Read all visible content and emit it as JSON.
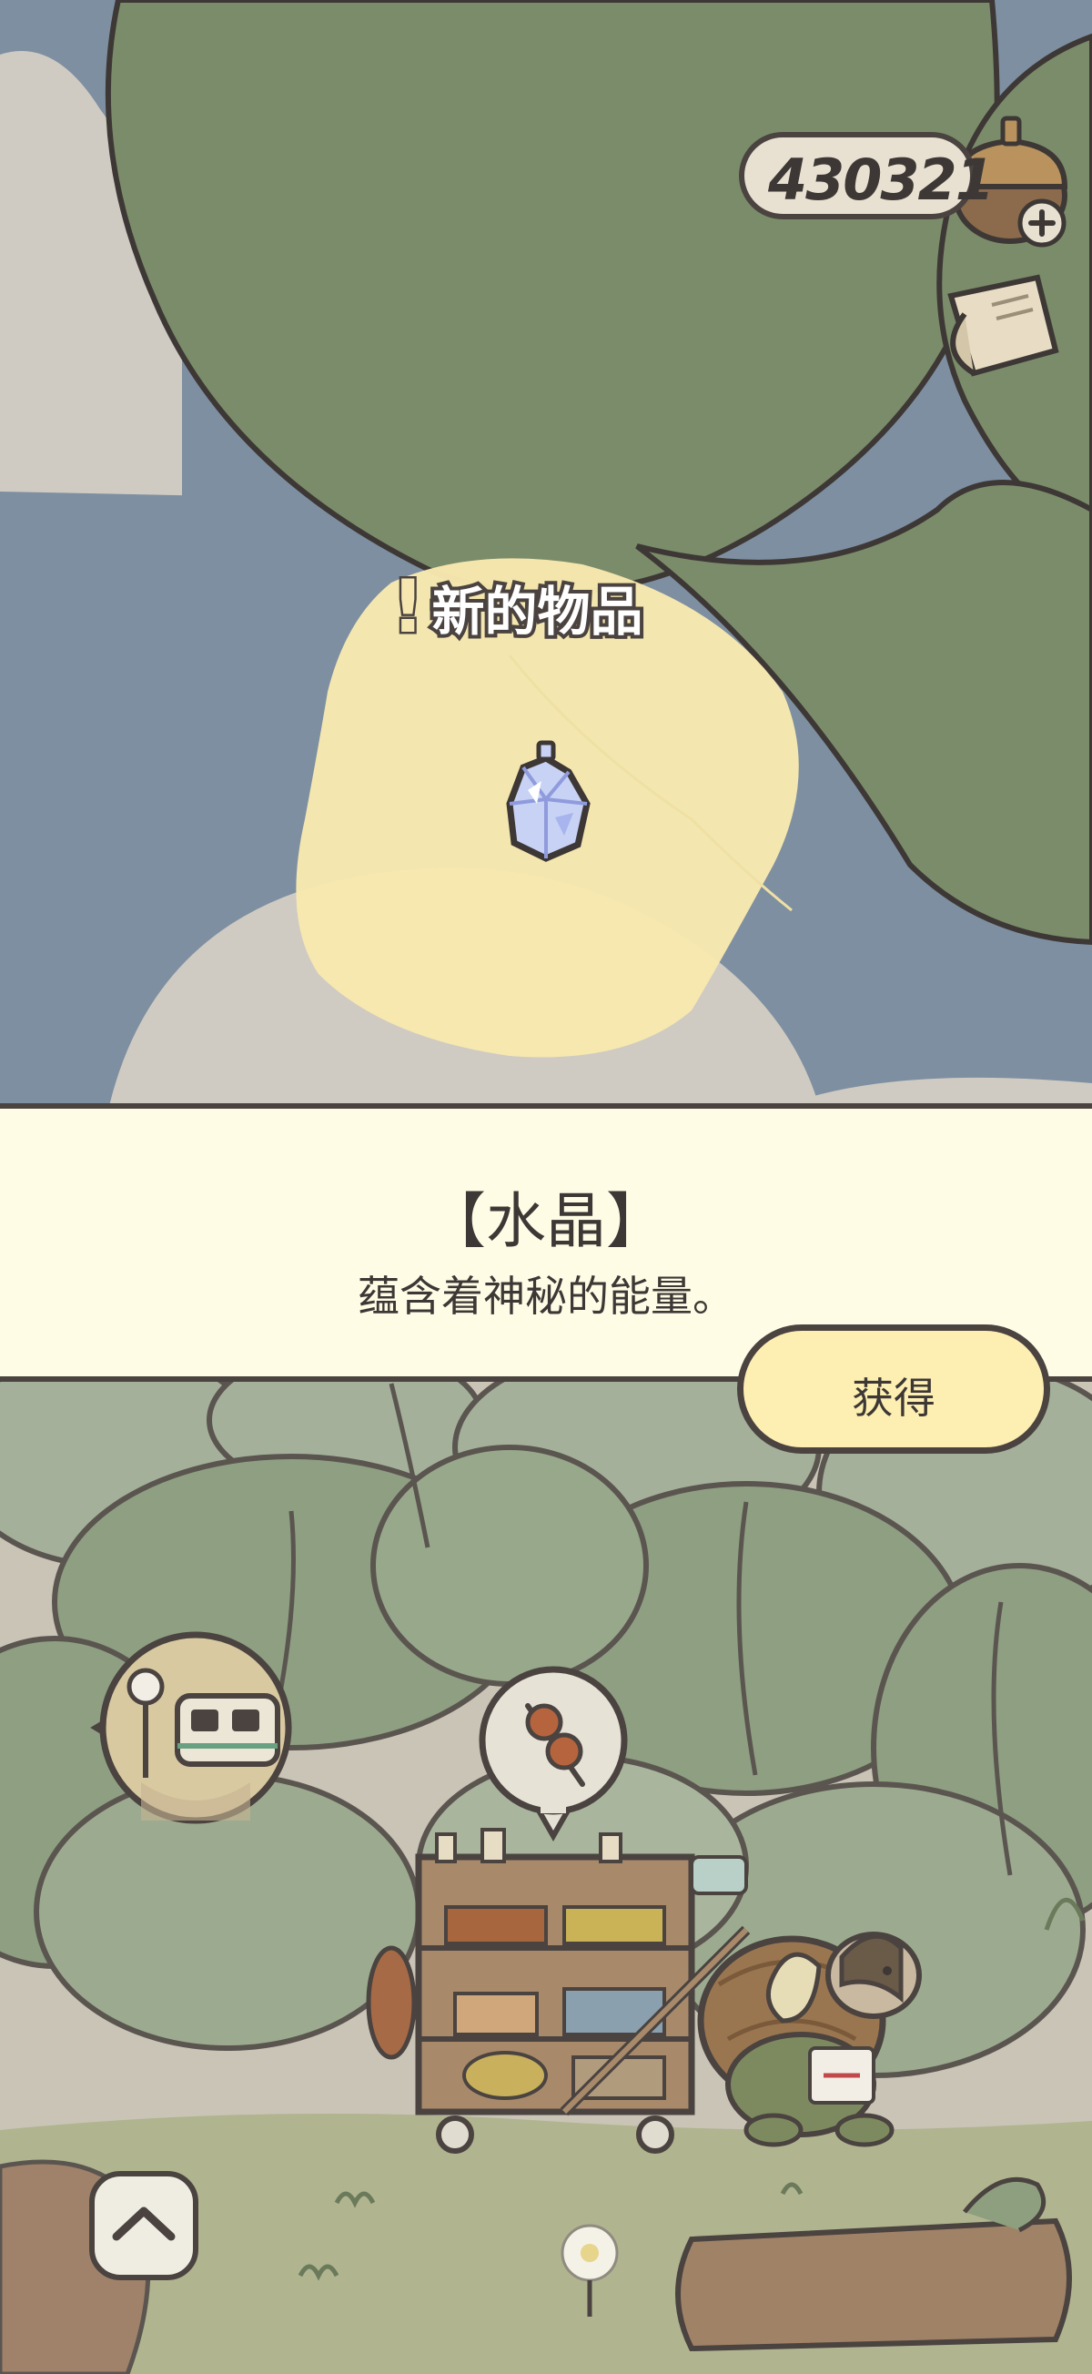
{
  "hud": {
    "acorn_count": "430321",
    "acorn_icon": "acorn-icon",
    "add_icon": "plus-icon",
    "letter_icon": "letter-icon"
  },
  "map": {
    "new_item_label": "新的物品",
    "new_item_mark": "!",
    "item_icon": "crystal-icon"
  },
  "dialog": {
    "item_name": "【水晶】",
    "item_description": "蕴含着神秘的能量。",
    "obtain_label": "获得"
  },
  "scene": {
    "train_bubble_icon": "train-station-icon",
    "dango_bubble_icon": "dango-icon",
    "scroll_up_icon": "chevron-up-icon"
  },
  "colors": {
    "sky": "#7e8fa1",
    "leaf_green": "#7b8c6a",
    "highlight_yellow": "#f8e8b0",
    "panel_bg": "#fffce6",
    "button_bg": "#fdeeb2",
    "outline": "#4a4340"
  }
}
